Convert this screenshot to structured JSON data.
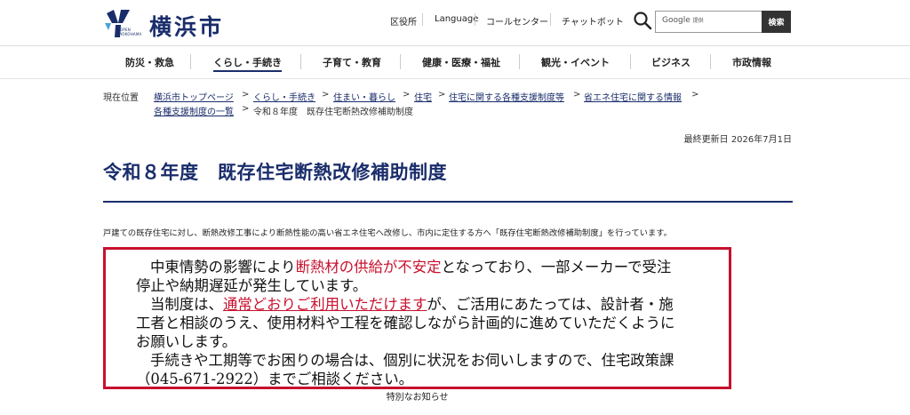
{
  "header": {
    "logo_sub1": "OPEN",
    "logo_sub2": "YOKOHAMA",
    "logo_text": "横浜市",
    "links": [
      "区役所",
      "Language",
      "コールセンター",
      "チャットボット"
    ],
    "search_brand": "Google",
    "search_brand_small": "提供",
    "search_button": "検索"
  },
  "nav": {
    "items": [
      "防災・救急",
      "くらし・手続き",
      "子育て・教育",
      "健康・医療・福祉",
      "観光・イベント",
      "ビジネス",
      "市政情報"
    ],
    "active_index": 1
  },
  "breadcrumb": {
    "label": "現在位置",
    "links": [
      "横浜市トップページ",
      "くらし・手続き",
      "住まい・暮らし",
      "住宅",
      "住宅に関する各種支援制度等",
      "省エネ住宅に関する情報",
      "各種支援制度の一覧"
    ],
    "separator": ">",
    "current": "令和８年度　既存住宅断熱改修補助制度"
  },
  "updated": "最終更新日  2026年7月1日",
  "page_title": "令和８年度　既存住宅断熱改修補助制度",
  "intro": "戸建ての既存住宅に対し、断熱改修工事により断熱性能の高い省エネ住宅へ改修し、市内に定住する方へ「既存住宅断熱改修補助制度」を行っています。",
  "notice": {
    "l1a": "中東情勢の影響により",
    "l1b": "断熱材の供給が不安定",
    "l1c": "となっており、一部メーカーで受注",
    "l2": "停止や納期遅延が発生しています。",
    "l3a": "当制度は、",
    "l3b": "通常どおりご利用いただけます",
    "l3c": "が、ご活用にあたっては、設計者・施",
    "l4": "工者と相談のうえ、使用材料や工程を確認しながら計画的に進めていただくように",
    "l5": "お願いします。",
    "l6": "手続きや工期等でお困りの場合は、個別に状況をお伺いしますので、住宅政策課",
    "l7": "（045-671-2922）までご相談ください。"
  },
  "caption": "特別なお知らせ",
  "colors": {
    "brand": "#1a2d6b",
    "alert": "#c8102e"
  }
}
